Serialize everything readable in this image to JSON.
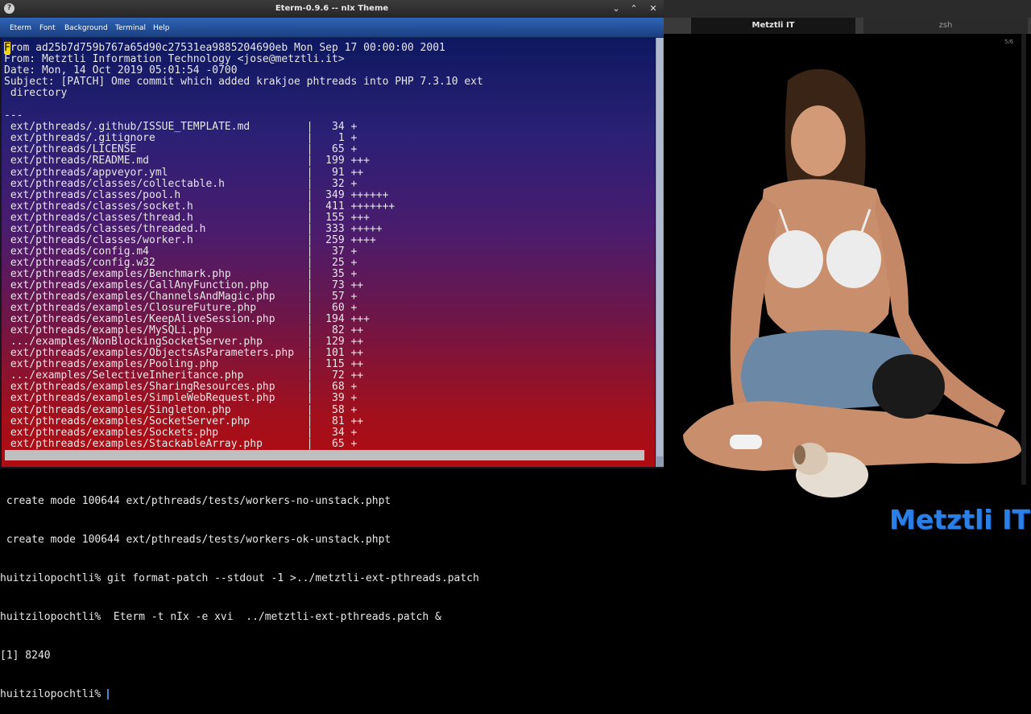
{
  "eterm": {
    "title": "Eterm-0.9.6 -- nIx Theme",
    "menu": [
      "Eterm",
      "Font",
      "Background",
      "Terminal",
      "Help"
    ],
    "buttons": {
      "minimize": "⌄",
      "maximize": "⌃",
      "close": "✕"
    },
    "cursor_char": "F",
    "lines": [
      "rom ad25b7d759b767a65d90c27531ea9885204690eb Mon Sep 17 00:00:00 2001",
      "From: Metztli Information Technology <jose@metztli.it>",
      "Date: Mon, 14 Oct 2019 05:01:54 -0700",
      "Subject: [PATCH] Ome commit which added krakjoe phtreads into PHP 7.3.10 ext",
      " directory",
      "",
      "---",
      " ext/pthreads/.github/ISSUE_TEMPLATE.md         |   34 +",
      " ext/pthreads/.gitignore                        |    1 +",
      " ext/pthreads/LICENSE                           |   65 +",
      " ext/pthreads/README.md                         |  199 +++",
      " ext/pthreads/appveyor.yml                      |   91 ++",
      " ext/pthreads/classes/collectable.h             |   32 +",
      " ext/pthreads/classes/pool.h                    |  349 ++++++",
      " ext/pthreads/classes/socket.h                  |  411 +++++++",
      " ext/pthreads/classes/thread.h                  |  155 +++",
      " ext/pthreads/classes/threaded.h                |  333 +++++",
      " ext/pthreads/classes/worker.h                  |  259 ++++",
      " ext/pthreads/config.m4                         |   37 +",
      " ext/pthreads/config.w32                        |   25 +",
      " ext/pthreads/examples/Benchmark.php            |   35 +",
      " ext/pthreads/examples/CallAnyFunction.php      |   73 ++",
      " ext/pthreads/examples/ChannelsAndMagic.php     |   57 +",
      " ext/pthreads/examples/ClosureFuture.php        |   60 +",
      " ext/pthreads/examples/KeepAliveSession.php     |  194 +++",
      " ext/pthreads/examples/MySQLi.php               |   82 ++",
      " .../examples/NonBlockingSocketServer.php       |  129 ++",
      " ext/pthreads/examples/ObjectsAsParameters.php  |  101 ++",
      " ext/pthreads/examples/Pooling.php              |  115 ++",
      " .../examples/SelectiveInheritance.php          |   72 ++",
      " ext/pthreads/examples/SharingResources.php     |   68 +",
      " ext/pthreads/examples/SimpleWebRequest.php     |   39 +",
      " ext/pthreads/examples/Singleton.php            |   58 +",
      " ext/pthreads/examples/SocketServer.php         |   81 ++",
      " ext/pthreads/examples/Sockets.php              |   34 +",
      " ext/pthreads/examples/StackableArray.php       |   65 +"
    ]
  },
  "zsh": {
    "tabs": [
      "Metztli IT",
      "zsh"
    ],
    "scroll_indicator": "5/6",
    "lines": [
      " create mode 100644 ext/pthreads/tests/workers-no-unstack.phpt",
      " create mode 100644 ext/pthreads/tests/workers-ok-unstack.phpt",
      "huitzilopochtli% git format-patch --stdout -1 >../metztli-ext-pthreads.patch",
      "huitzilopochtli%  Eterm -t nIx -e xvi  ../metztli-ext-pthreads.patch &",
      "[1] 8240",
      "huitzilopochtli% "
    ]
  },
  "logo_text": "Metztli IT"
}
